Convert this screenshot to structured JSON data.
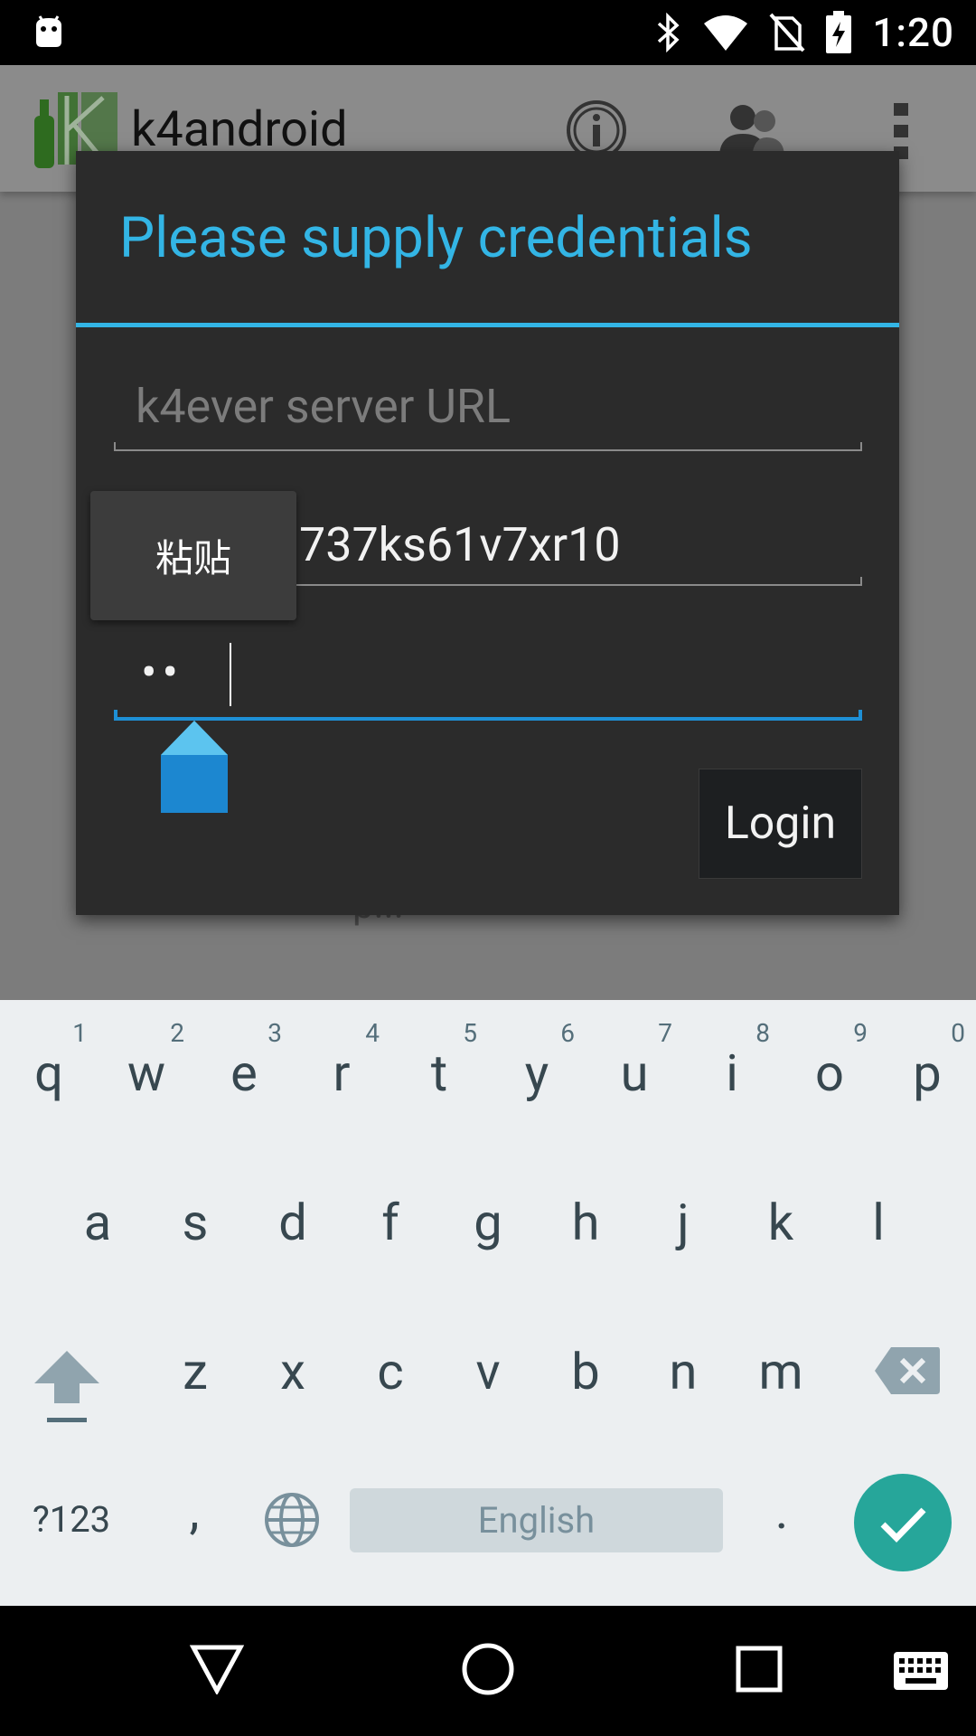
{
  "status_bar": {
    "time": "1:20"
  },
  "app_bar": {
    "title": "k4android"
  },
  "background": {
    "partial_text": "p..."
  },
  "dialog": {
    "title": "Please supply credentials",
    "url_field": {
      "placeholder": "k4ever server URL",
      "value": ""
    },
    "username_field": {
      "value": "737ks61v7xr10"
    },
    "password_field": {
      "value": "••"
    },
    "paste_popup_label": "粘贴",
    "login_label": "Login"
  },
  "keyboard": {
    "row1": [
      {
        "ch": "q",
        "num": "1"
      },
      {
        "ch": "w",
        "num": "2"
      },
      {
        "ch": "e",
        "num": "3"
      },
      {
        "ch": "r",
        "num": "4"
      },
      {
        "ch": "t",
        "num": "5"
      },
      {
        "ch": "y",
        "num": "6"
      },
      {
        "ch": "u",
        "num": "7"
      },
      {
        "ch": "i",
        "num": "8"
      },
      {
        "ch": "o",
        "num": "9"
      },
      {
        "ch": "p",
        "num": "0"
      }
    ],
    "row2": [
      "a",
      "s",
      "d",
      "f",
      "g",
      "h",
      "j",
      "k",
      "l"
    ],
    "row3": [
      "z",
      "x",
      "c",
      "v",
      "b",
      "n",
      "m"
    ],
    "symbols_label": "?123",
    "comma_label": ",",
    "space_label": "English",
    "period_label": "."
  },
  "colors": {
    "accent": "#33b5e5",
    "focus_line": "#1e90d6",
    "enter_key": "#26a69a"
  }
}
